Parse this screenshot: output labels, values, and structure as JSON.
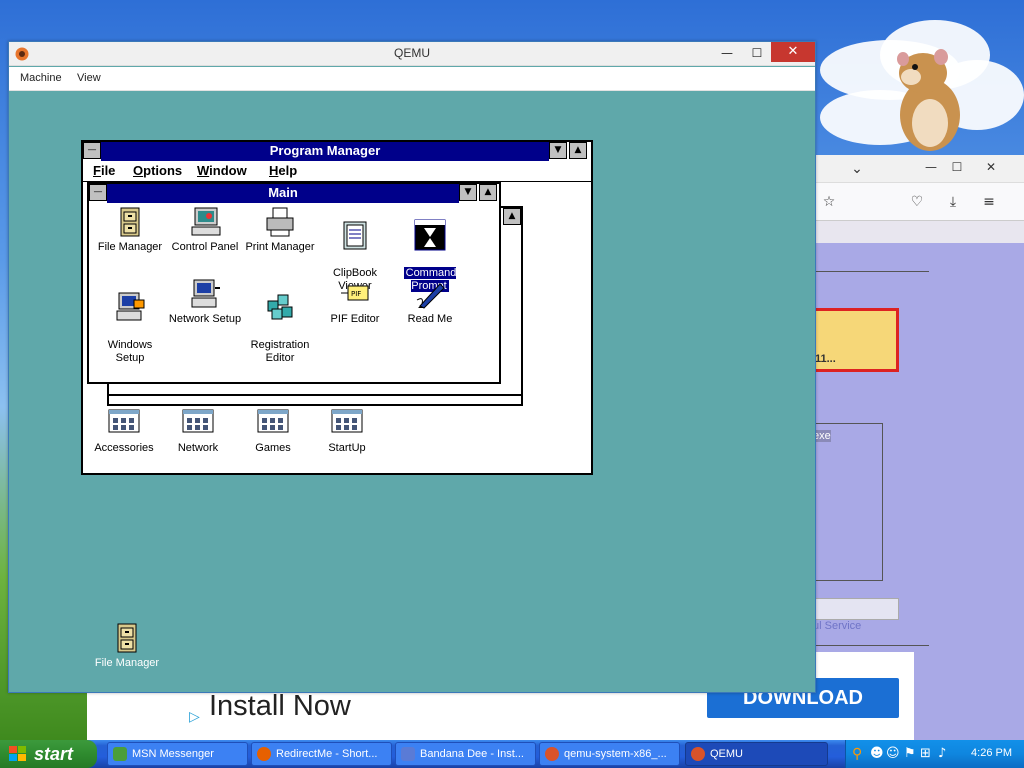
{
  "desktop": {
    "background_colors": {
      "sky": "#2e6fd6",
      "grass": "#3f8a1e"
    }
  },
  "background_browser": {
    "menu_chevron": "⌄",
    "win_buttons": [
      "—",
      "☐",
      "✕"
    ],
    "toolbar_icons": [
      "star-icon",
      "pocket-icon",
      "download-icon",
      "menu-icon"
    ],
    "partial_text_1": "11...",
    "partial_text_2": "exe",
    "partial_text_3": "ul Service"
  },
  "qemu": {
    "title": "QEMU",
    "menu": [
      "Machine",
      "View"
    ],
    "win_buttons": {
      "minimize": "—",
      "maximize": "☐",
      "close": "✕"
    }
  },
  "program_manager": {
    "title": "Program Manager",
    "menu": [
      {
        "accel": "F",
        "rest": "ile"
      },
      {
        "accel": "O",
        "rest": "ptions"
      },
      {
        "accel": "W",
        "rest": "indow"
      },
      {
        "accel": "H",
        "rest": "elp"
      }
    ],
    "groups": [
      {
        "label": "Accessories"
      },
      {
        "label": "Network"
      },
      {
        "label": "Games"
      },
      {
        "label": "StartUp"
      }
    ]
  },
  "main_group": {
    "title": "Main",
    "icons": [
      {
        "label": "File Manager",
        "icon": "file-cabinet-icon"
      },
      {
        "label": "Control Panel",
        "icon": "control-panel-icon"
      },
      {
        "label": "Print Manager",
        "icon": "printer-icon"
      },
      {
        "label": "ClipBook\nViewer",
        "icon": "clipbook-icon"
      },
      {
        "label": "Command\nPrompt",
        "icon": "ms-dos-icon",
        "selected": true
      },
      {
        "label": "Windows\nSetup",
        "icon": "windows-setup-icon"
      },
      {
        "label": "Network Setup",
        "icon": "network-setup-icon"
      },
      {
        "label": "Registration\nEditor",
        "icon": "registry-icon"
      },
      {
        "label": "PIF Editor",
        "icon": "pif-icon"
      },
      {
        "label": "Read Me",
        "icon": "read-me-icon"
      }
    ]
  },
  "minimized_icon": {
    "label": "File Manager"
  },
  "ad": {
    "headline": "Install Now",
    "button": "DOWNLOAD"
  },
  "taskbar": {
    "start_label": "start",
    "tasks": [
      {
        "label": "MSN Messenger",
        "color": "#4b9e3a"
      },
      {
        "label": "RedirectMe - Short...",
        "color": "#e66000"
      },
      {
        "label": "Bandana Dee - Inst...",
        "color": "#5a7bd6"
      },
      {
        "label": "qemu-system-x86_...",
        "color": "#d9532a"
      },
      {
        "label": "QEMU",
        "color": "#d9532a",
        "active": true
      }
    ],
    "clock": "4:26 PM"
  }
}
